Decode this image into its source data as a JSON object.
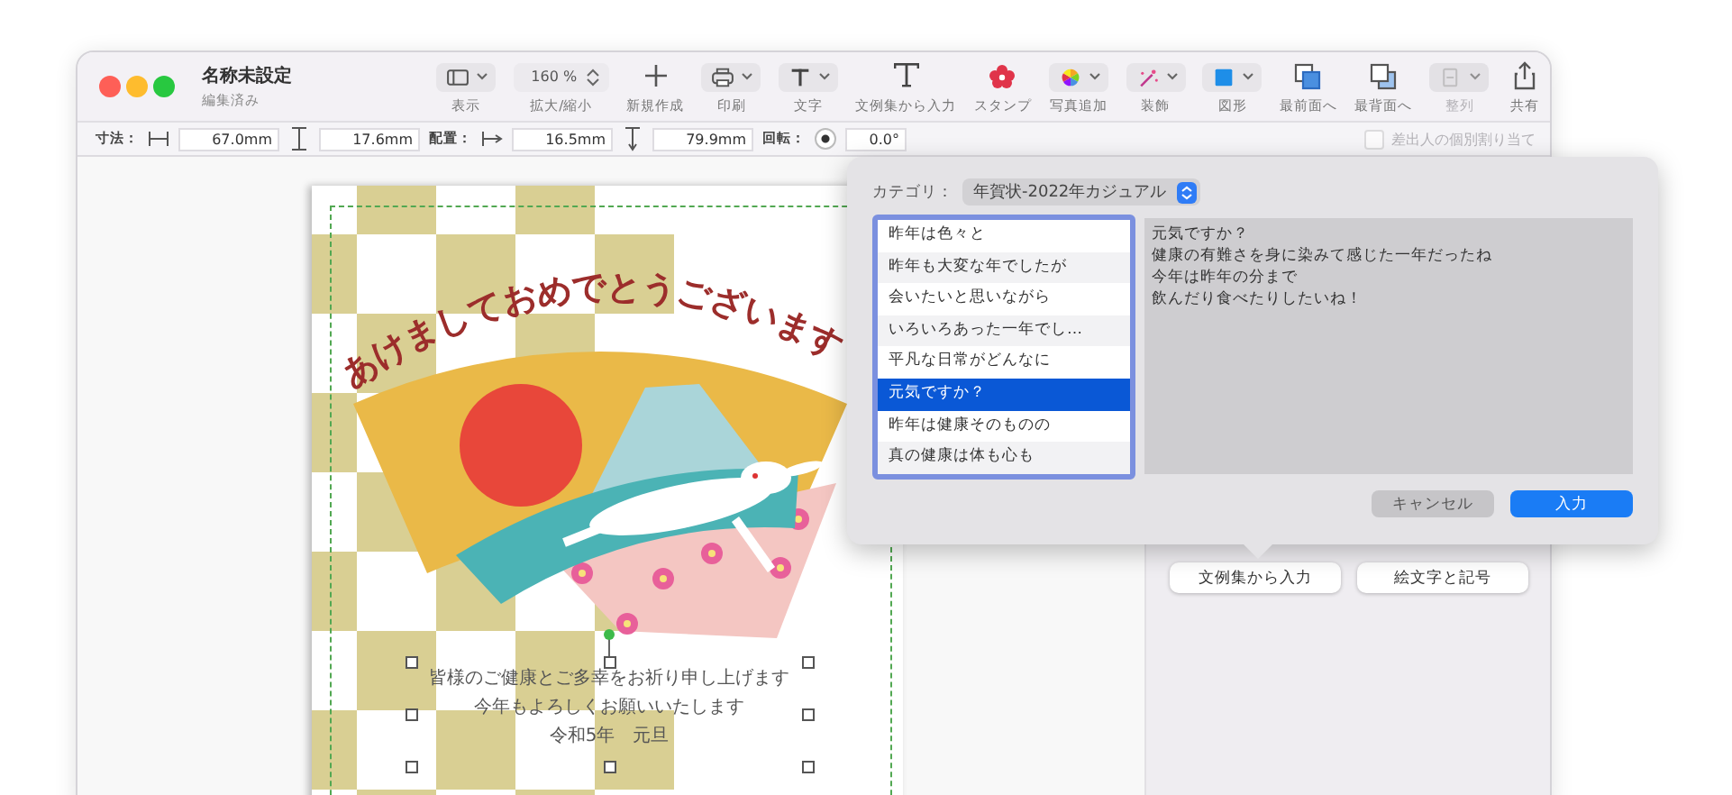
{
  "window": {
    "title": "名称未設定",
    "subtitle": "編集済み"
  },
  "toolbar": [
    {
      "label": "表示",
      "kind": "dropdown",
      "disabled": false
    },
    {
      "label": "拡大/縮小",
      "kind": "zoom",
      "value": "160 %",
      "disabled": false
    },
    {
      "label": "新規作成",
      "kind": "button",
      "disabled": false
    },
    {
      "label": "印刷",
      "kind": "dropdown",
      "disabled": false
    },
    {
      "label": "文字",
      "kind": "dropdown",
      "disabled": false
    },
    {
      "label": "文例集から入力",
      "kind": "button",
      "disabled": false
    },
    {
      "label": "スタンプ",
      "kind": "button",
      "disabled": false
    },
    {
      "label": "写真追加",
      "kind": "dropdown",
      "disabled": false
    },
    {
      "label": "装飾",
      "kind": "dropdown",
      "disabled": false
    },
    {
      "label": "図形",
      "kind": "dropdown",
      "disabled": false
    },
    {
      "label": "最前面へ",
      "kind": "button",
      "disabled": false
    },
    {
      "label": "最背面へ",
      "kind": "button",
      "disabled": false
    },
    {
      "label": "整列",
      "kind": "dropdown",
      "disabled": true
    },
    {
      "label": "共有",
      "kind": "button",
      "disabled": false
    }
  ],
  "format_bar": {
    "groups": [
      {
        "label": "寸法：",
        "fields": [
          "67.0mm",
          "17.6mm"
        ]
      },
      {
        "label": "配置：",
        "fields": [
          "16.5mm",
          "79.9mm"
        ]
      },
      {
        "label": "回転：",
        "fields": [
          "0.0°"
        ]
      }
    ],
    "assign_checkbox": {
      "label": "差出人の個別割り当て",
      "checked": false,
      "disabled": true
    }
  },
  "card": {
    "greeting": "あけましておめでとうございます",
    "message_lines": [
      "皆様のご健康とご多幸をお祈り申し上げます",
      "今年もよろしくお願いいたします",
      "令和5年　元旦"
    ]
  },
  "inspector": {
    "buttons": [
      "文例集から入力",
      "絵文字と記号"
    ]
  },
  "dialog": {
    "category_label": "カテゴリ：",
    "category": "年賀状-2022年カジュアル",
    "items": [
      {
        "label": "昨年は色々と",
        "selected": false
      },
      {
        "label": "昨年も大変な年でしたが",
        "selected": false
      },
      {
        "label": "会いたいと思いながら",
        "selected": false
      },
      {
        "label": "いろいろあった一年でし…",
        "selected": false
      },
      {
        "label": "平凡な日常がどんなに",
        "selected": false
      },
      {
        "label": "元気ですか？",
        "selected": true
      },
      {
        "label": "昨年は健康そのものの",
        "selected": false
      },
      {
        "label": "真の健康は体も心も",
        "selected": false
      }
    ],
    "preview_lines": [
      "元気ですか？",
      "健康の有難さを身に染みて感じた一年だったね",
      "今年は昨年の分まで",
      "飲んだり食べたりしたいね！"
    ],
    "buttons": [
      {
        "label": "キャンセル",
        "kind": "secondary"
      },
      {
        "label": "入力",
        "kind": "primary"
      }
    ]
  }
}
